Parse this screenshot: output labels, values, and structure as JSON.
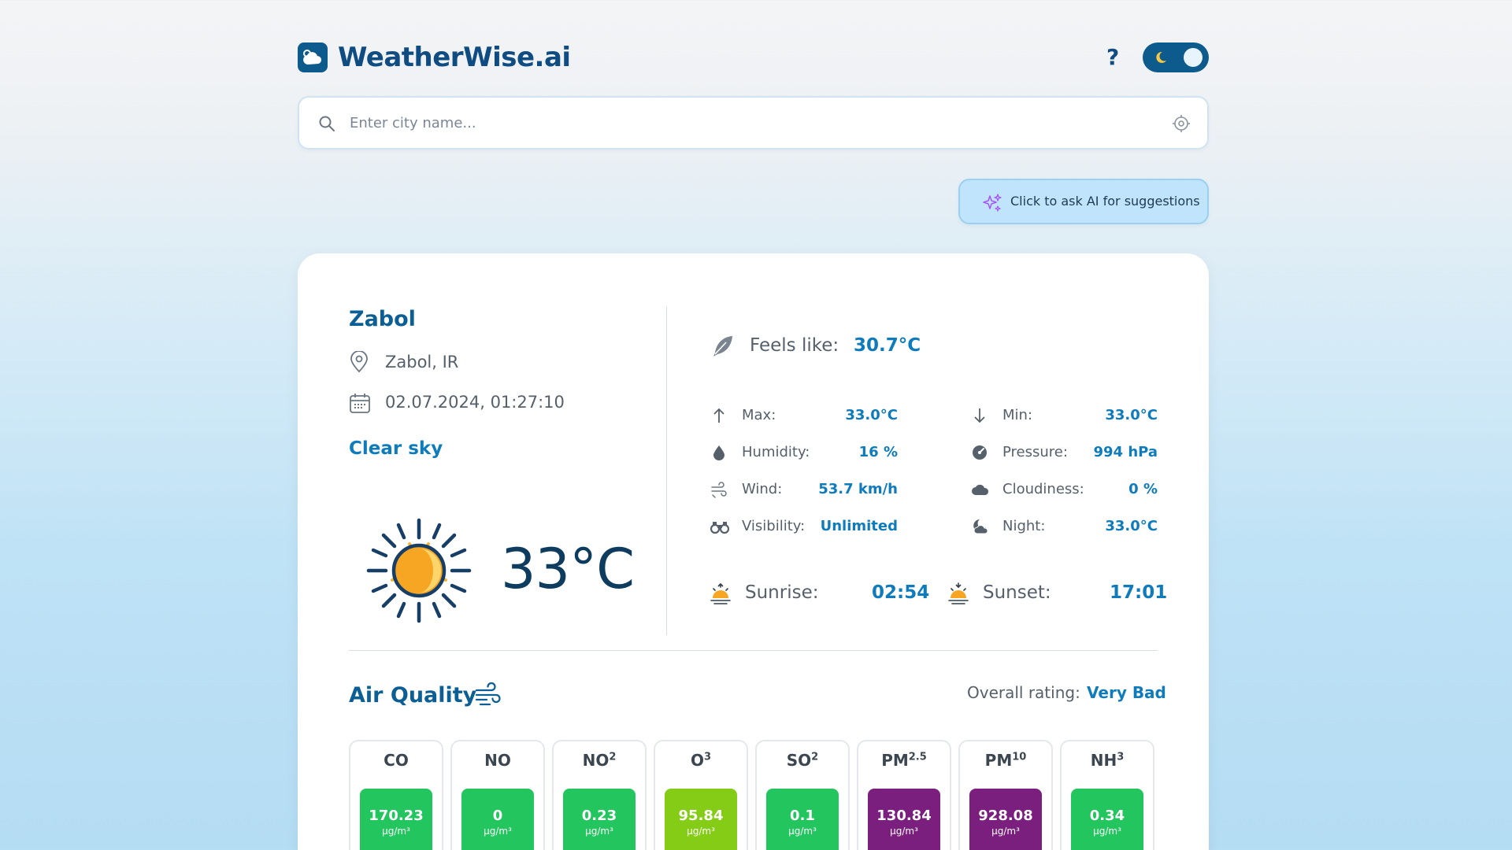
{
  "header": {
    "logo_text": "WeatherWise.ai",
    "help_label": "?"
  },
  "search": {
    "placeholder": "Enter city name..."
  },
  "ai_button": {
    "label": "Click to ask AI for suggestions"
  },
  "current": {
    "city": "Zabol",
    "location": "Zabol, IR",
    "datetime": "02.07.2024, 01:27:10",
    "description": "Clear sky",
    "temperature": "33°C",
    "feels_like_label": "Feels like:",
    "feels_like_value": "30.7°C"
  },
  "stats_left": [
    {
      "label": "Max:",
      "value": "33.0°C",
      "icon": "arrow-up-icon"
    },
    {
      "label": "Humidity:",
      "value": "16 %",
      "icon": "droplet-icon"
    },
    {
      "label": "Wind:",
      "value": "53.7 km/h",
      "icon": "wind-icon"
    },
    {
      "label": "Visibility:",
      "value": "Unlimited",
      "icon": "binoculars-icon"
    }
  ],
  "stats_right": [
    {
      "label": "Min:",
      "value": "33.0°C",
      "icon": "arrow-down-icon"
    },
    {
      "label": "Pressure:",
      "value": "994 hPa",
      "icon": "gauge-icon"
    },
    {
      "label": "Cloudiness:",
      "value": "0 %",
      "icon": "cloud-icon"
    },
    {
      "label": "Night:",
      "value": "33.0°C",
      "icon": "moon-cloud-icon"
    }
  ],
  "sun": {
    "sunrise_label": "Sunrise:",
    "sunrise_value": "02:54",
    "sunset_label": "Sunset:",
    "sunset_value": "17:01"
  },
  "air_quality": {
    "title": "Air Quality",
    "rating_label": "Overall rating:",
    "rating_value": "Very Bad",
    "unit": "μg/m³",
    "pollutants": [
      {
        "name": "CO",
        "sub": "",
        "value": "170.23",
        "color": "#22c55e"
      },
      {
        "name": "NO",
        "sub": "",
        "value": "0",
        "color": "#22c55e"
      },
      {
        "name": "NO",
        "sub": "2",
        "value": "0.23",
        "color": "#22c55e"
      },
      {
        "name": "O",
        "sub": "3",
        "value": "95.84",
        "color": "#84cc16"
      },
      {
        "name": "SO",
        "sub": "2",
        "value": "0.1",
        "color": "#22c55e"
      },
      {
        "name": "PM",
        "sub": "2.5",
        "value": "130.84",
        "color": "#7b1f7e"
      },
      {
        "name": "PM",
        "sub": "10",
        "value": "928.08",
        "color": "#7b1f7e"
      },
      {
        "name": "NH",
        "sub": "3",
        "value": "0.34",
        "color": "#22c55e"
      }
    ]
  },
  "colors": {
    "brand": "#0d5a8c",
    "accent": "#0e7bbd",
    "good": "#22c55e",
    "moderate": "#84cc16",
    "very_bad": "#7b1f7e"
  }
}
